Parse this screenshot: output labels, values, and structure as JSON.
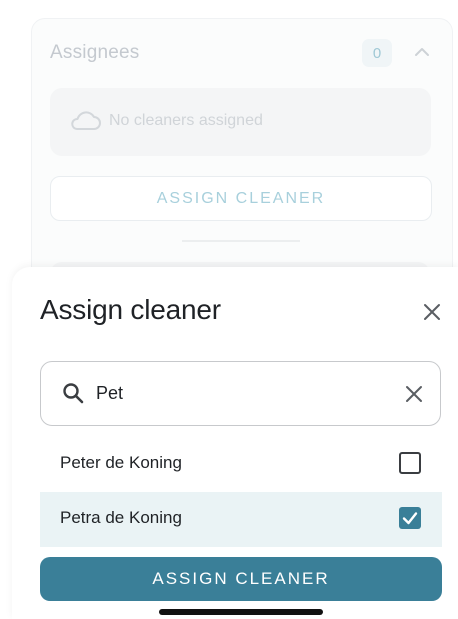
{
  "background_card": {
    "title": "Assignees",
    "count": "0",
    "chevron_icon": "chevron-up-icon",
    "empty_icon": "cloud-icon",
    "empty_text": "No cleaners assigned",
    "assign_button": "ASSIGN CLEANER"
  },
  "sheet": {
    "title": "Assign cleaner",
    "close_icon": "close-icon",
    "search": {
      "icon": "search-icon",
      "value": "Pet",
      "clear_icon": "clear-icon"
    },
    "options": [
      {
        "label": "Peter de Koning",
        "checked": false
      },
      {
        "label": "Petra de Koning",
        "checked": true
      }
    ],
    "submit_button": "ASSIGN CLEANER"
  },
  "colors": {
    "accent": "#3a7f98",
    "selected_row": "#eaf3f5",
    "text": "#1f2226"
  }
}
